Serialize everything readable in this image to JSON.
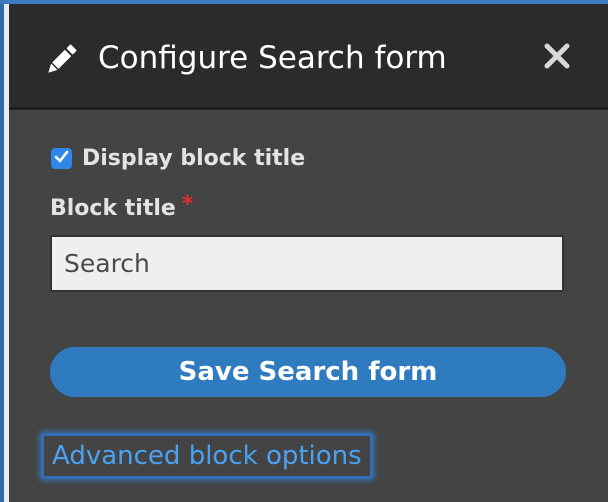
{
  "dialog": {
    "title": "Configure Search form",
    "header_icon": "pencil-icon",
    "close_icon": "close-icon"
  },
  "form": {
    "display_title_checkbox": {
      "label": "Display block title",
      "checked": true
    },
    "block_title": {
      "label": "Block title",
      "required_mark": "*",
      "value": "Search"
    },
    "save_button_label": "Save Search form",
    "advanced_link_label": "Advanced block options"
  },
  "colors": {
    "accent": "#2f7bbf",
    "link": "#4aa2f4",
    "required": "#e03131",
    "panel_bg": "#444444",
    "header_bg": "#2b2b2b"
  }
}
